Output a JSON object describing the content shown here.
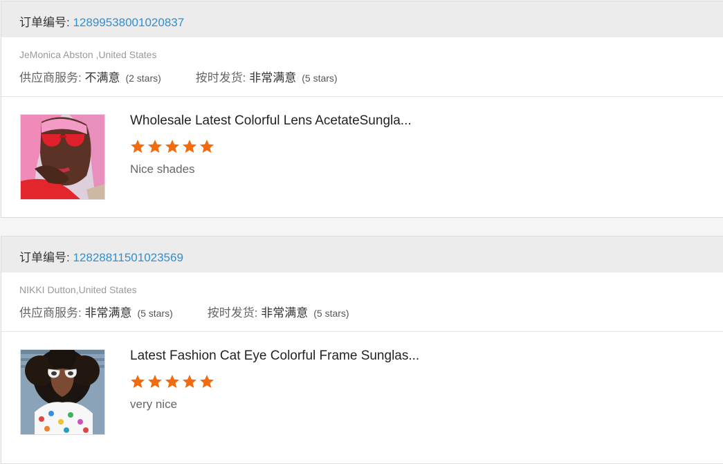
{
  "orders": [
    {
      "order_label": "订单编号",
      "order_number": "12899538001020837",
      "buyer": "JeMonica Abston ,United States",
      "supplier_service_label": "供应商服务",
      "supplier_service_value": "不满意",
      "supplier_service_stars": "(2 stars)",
      "shipping_label": "按时发货",
      "shipping_value": "非常满意",
      "shipping_stars": "(5 stars)",
      "product_title": "Wholesale Latest Colorful Lens AcetateSungla...",
      "product_rating": 5,
      "comment": "Nice shades",
      "thumbnail_icon": "product-photo-pink-hair-red-sunglasses"
    },
    {
      "order_label": "订单编号",
      "order_number": "12828811501023569",
      "buyer": "NIKKI Dutton,United States",
      "supplier_service_label": "供应商服务",
      "supplier_service_value": "非常满意",
      "supplier_service_stars": "(5 stars)",
      "shipping_label": "按时发货",
      "shipping_value": "非常满意",
      "shipping_stars": "(5 stars)",
      "product_title": "Latest Fashion Cat Eye Colorful Frame Sunglas...",
      "product_rating": 5,
      "comment": "very nice",
      "thumbnail_icon": "product-photo-cat-eye-white-sunglasses"
    }
  ],
  "colors": {
    "header_bg": "#ececec",
    "order_number": "#2f8fd0",
    "star": "#f26b0f"
  }
}
